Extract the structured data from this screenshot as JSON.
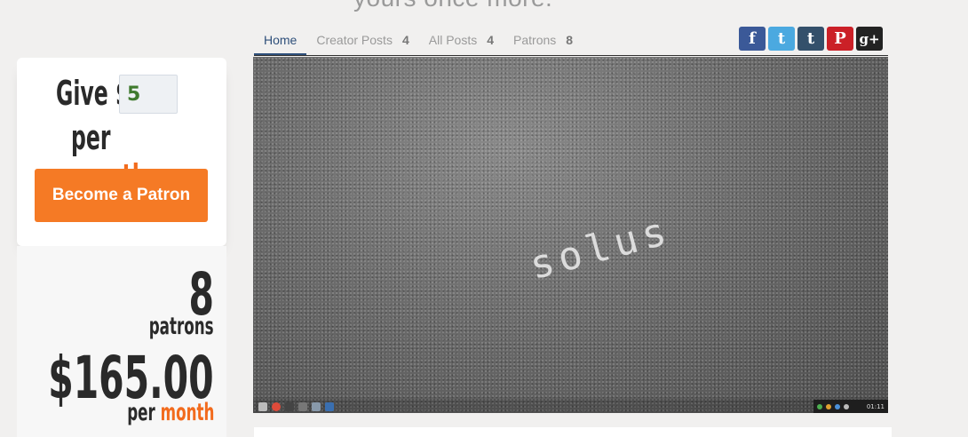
{
  "header": {
    "headline_fragment": "yours once more."
  },
  "tabs": [
    {
      "label": "Home",
      "count": ""
    },
    {
      "label": "Creator Posts",
      "count": "4"
    },
    {
      "label": "All Posts",
      "count": "4"
    },
    {
      "label": "Patrons",
      "count": "8"
    }
  ],
  "social": {
    "facebook": "f",
    "twitter": "t",
    "tumblr": "t",
    "pinterest": "P",
    "googleplus": "g+",
    "colors": {
      "facebook": "#3b5998",
      "twitter": "#4ba9e0",
      "tumblr": "#34506b",
      "pinterest": "#cb2027",
      "googleplus": "#222222"
    }
  },
  "pledge": {
    "give_label": "Give $",
    "amount_value": "5",
    "per_label": "per",
    "month_label": "month",
    "button_label": "Become a Patron"
  },
  "stats": {
    "patrons_count": "8",
    "patrons_label": "patrons",
    "amount": "$165.00",
    "per_label": "per",
    "month_label": "month"
  },
  "hero": {
    "word": "solus",
    "clock": "01:11"
  },
  "colors": {
    "accent": "#f57a25",
    "tab_active": "#2e4f7a"
  }
}
